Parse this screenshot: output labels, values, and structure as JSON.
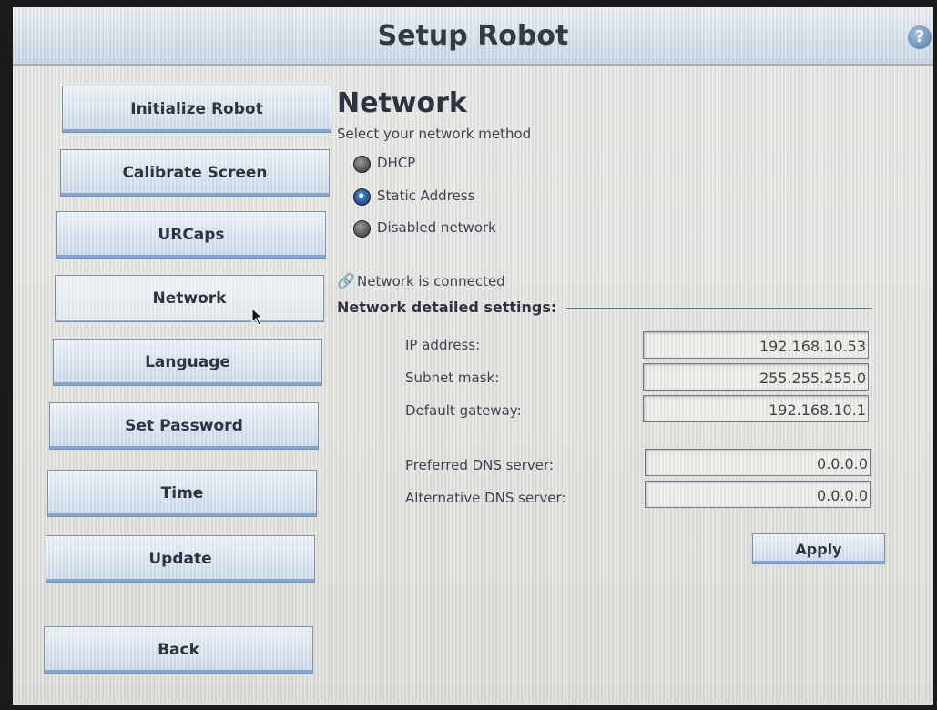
{
  "header": {
    "title": "Setup Robot",
    "help_icon": "?"
  },
  "sidebar": {
    "items": [
      {
        "label": "Initialize Robot",
        "active": false
      },
      {
        "label": "Calibrate Screen",
        "active": false
      },
      {
        "label": "URCaps",
        "active": false
      },
      {
        "label": "Network",
        "active": true
      },
      {
        "label": "Language",
        "active": false
      },
      {
        "label": "Set Password",
        "active": false
      },
      {
        "label": "Time",
        "active": false
      },
      {
        "label": "Update",
        "active": false
      },
      {
        "label": "Back",
        "active": false
      }
    ]
  },
  "main": {
    "title": "Network",
    "method_prompt": "Select your network method",
    "methods": [
      {
        "label": "DHCP",
        "selected": false
      },
      {
        "label": "Static Address",
        "selected": true
      },
      {
        "label": "Disabled network",
        "selected": false
      }
    ],
    "status_icon": "link-icon",
    "status_text": "Network is connected",
    "details_heading": "Network detailed settings:",
    "fields": {
      "ip_address": {
        "label": "IP address:",
        "value": "192.168.10.53"
      },
      "subnet_mask": {
        "label": "Subnet mask:",
        "value": "255.255.255.0"
      },
      "default_gateway": {
        "label": "Default gateway:",
        "value": "192.168.10.1"
      },
      "preferred_dns": {
        "label": "Preferred DNS server:",
        "value": "0.0.0.0"
      },
      "alternative_dns": {
        "label": "Alternative DNS server:",
        "value": "0.0.0.0"
      }
    },
    "apply_label": "Apply"
  },
  "colors": {
    "accent": "#7fa7d1",
    "title_text": "#333a44",
    "selected_radio": "#3d7cc9"
  }
}
